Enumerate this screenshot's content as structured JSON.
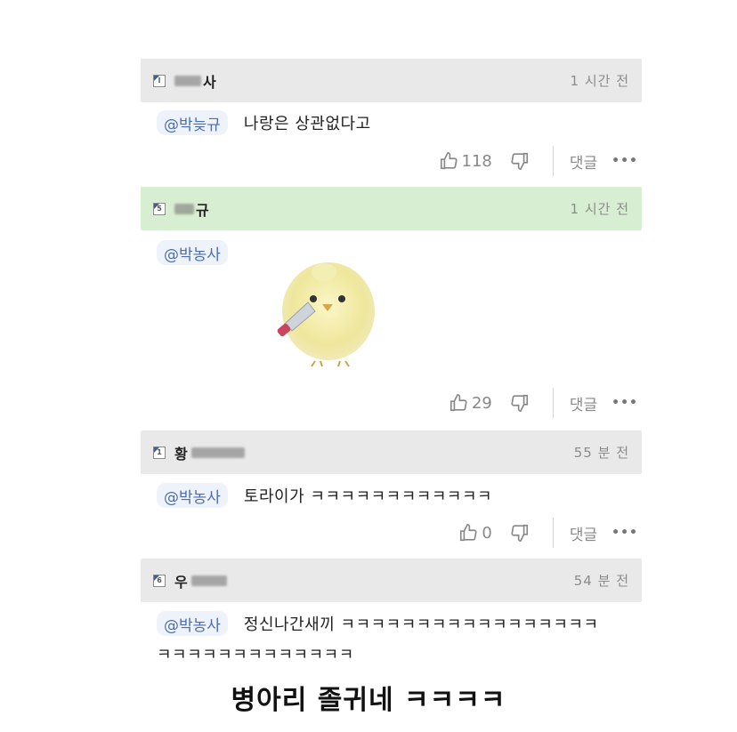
{
  "comments": [
    {
      "level": "l",
      "nick_suffix": "사",
      "time": "1 시간 전",
      "mention": "@박늦규",
      "text": "나랑은 상관없다고",
      "likes": "118",
      "reply_label": "댓글"
    },
    {
      "level": "5",
      "nick_suffix": "규",
      "time": "1 시간 전",
      "mention": "@박농사",
      "text": "",
      "likes": "29",
      "reply_label": "댓글",
      "image": "chick-with-knife"
    },
    {
      "level": "1",
      "nick_prefix": "황",
      "time": "55 분 전",
      "mention": "@박농사",
      "text": "토라이가 ㅋㅋㅋㅋㅋㅋㅋㅋㅋㅋㅋㅋ",
      "likes": "0",
      "reply_label": "댓글"
    },
    {
      "level": "6",
      "nick_prefix": "우",
      "time": "54 분 전",
      "mention": "@박농사",
      "text": "정신나간새끼 ㅋㅋㅋㅋㅋㅋㅋㅋㅋㅋㅋㅋㅋㅋㅋㅋㅋ",
      "text_line2": "ㅋㅋㅋㅋㅋㅋㅋㅋㅋㅋㅋㅋㅋ"
    }
  ],
  "caption": "병아리 졸귀네 ㅋㅋㅋㅋ",
  "colors": {
    "header_gray": "#e9e9ea",
    "header_green": "#d8eed2",
    "mention_blue": "#4a6fb0"
  }
}
